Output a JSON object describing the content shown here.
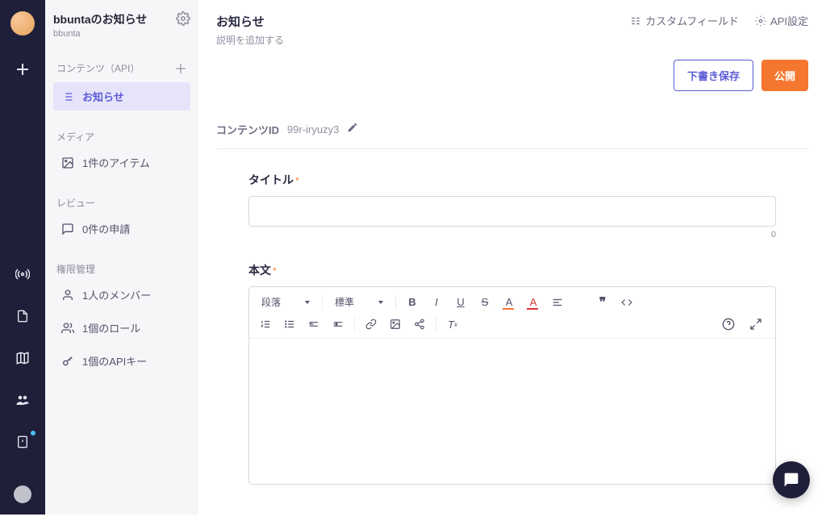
{
  "project": {
    "title": "bbuntaのお知らせ",
    "subtitle": "bbunta"
  },
  "sidebar": {
    "sections": {
      "content": {
        "header": "コンテンツ（API）",
        "items": [
          {
            "label": "お知らせ",
            "active": true
          }
        ]
      },
      "media": {
        "header": "メディア",
        "items": [
          {
            "label": "1件のアイテム"
          }
        ]
      },
      "review": {
        "header": "レビュー",
        "items": [
          {
            "label": "0件の申請"
          }
        ]
      },
      "perm": {
        "header": "権限管理",
        "items": [
          {
            "label": "1人のメンバー"
          },
          {
            "label": "1個のロール"
          },
          {
            "label": "1個のAPIキー"
          }
        ]
      }
    }
  },
  "header": {
    "title": "お知らせ",
    "desc_placeholder": "説明を追加する",
    "links": {
      "custom_fields": "カスタムフィールド",
      "api_settings": "API設定"
    },
    "buttons": {
      "draft": "下書き保存",
      "publish": "公開"
    }
  },
  "content_id": {
    "label": "コンテンツID",
    "value": "99r-iryuzy3"
  },
  "fields": {
    "title": {
      "label": "タイトル",
      "value": "",
      "count": "0"
    },
    "body": {
      "label": "本文"
    }
  },
  "editor": {
    "format_select": "段落",
    "style_select": "標準"
  }
}
